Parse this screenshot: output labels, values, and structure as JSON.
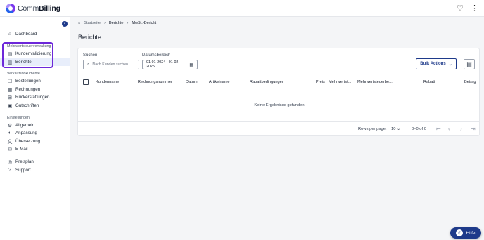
{
  "app": {
    "logo_prefix": "Comm",
    "logo_suffix": "Billing"
  },
  "topbar": {
    "heart_icon": "♡",
    "menu_icon": "⋮"
  },
  "sidebar": {
    "collapse_icon": "‹",
    "dashboard": "Dashboard",
    "section_tax": "Mehrwertsteuerverwaltung",
    "kundenvalidierung": "Kundenvalidierung",
    "berichte": "Berichte",
    "section_sales": "Verkaufsdokumente",
    "bestellungen": "Bestellungen",
    "rechnungen": "Rechnungen",
    "rueckerstattungen": "Rückerstattungen",
    "gutschriften": "Gutschriften",
    "section_settings": "Einstellungen",
    "allgemein": "Allgemein",
    "anpassung": "Anpassung",
    "uebersetzung": "Übersetzung",
    "email": "E-Mail",
    "preisplan": "Preisplan",
    "support": "Support",
    "highlight_color": "#6d28d9",
    "active_bg": "#e8eefb"
  },
  "breadcrumb": {
    "home": "Startseite",
    "sep": "›",
    "berichte": "Berichte",
    "current": "MwSt.-Bericht"
  },
  "page": {
    "title": "Berichte"
  },
  "filters": {
    "search_label": "Suchen",
    "search_placeholder": "Nach Kunden suchen",
    "date_label": "Datumsbereich",
    "date_value": "01-01-2024 - 01-02-2025",
    "bulk_actions": "Bulk Actions"
  },
  "table": {
    "columns": [
      "Kundenname",
      "Rechnungsnummer",
      "Datum",
      "Artikelname",
      "Rabattbedingungen",
      "Preis",
      "Mehrwertst...",
      "Mehrwertsteuerbe...",
      "Rabatt",
      "Betrag"
    ],
    "empty_text": "Keine Ergebnisse gefunden"
  },
  "pagination": {
    "rows_label": "Rows per page:",
    "rows_value": "10",
    "range": "0–0 of 0"
  },
  "help": {
    "label": "Hilfe"
  },
  "colors": {
    "accent": "#1e3a8a",
    "background": "#f4f5f7"
  }
}
